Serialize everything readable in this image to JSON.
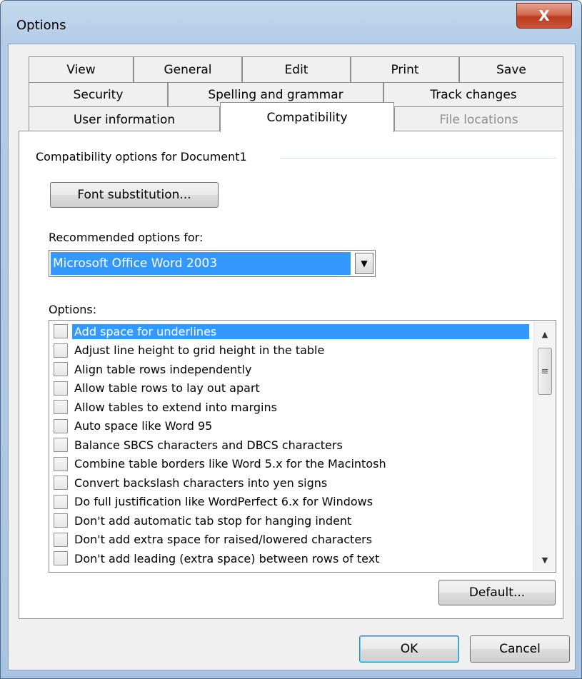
{
  "window": {
    "title": "Options",
    "close_label": "X"
  },
  "tabs": {
    "row1": [
      "View",
      "General",
      "Edit",
      "Print",
      "Save"
    ],
    "row2": [
      "Security",
      "Spelling and grammar",
      "Track changes"
    ],
    "row3": [
      "User information",
      "Compatibility",
      "File locations"
    ],
    "selected": "Compatibility",
    "disabled": "File locations"
  },
  "compat": {
    "group_label": "Compatibility options for Document1",
    "font_substitution_label": "Font substitution...",
    "recommended_label": "Recommended options for:",
    "recommended_value": "Microsoft Office Word 2003",
    "options_label": "Options:",
    "options": [
      "Add space for underlines",
      "Adjust line height to grid height in the table",
      "Align table rows independently",
      "Allow table rows to lay out apart",
      "Allow tables to extend into margins",
      "Auto space like Word 95",
      "Balance SBCS characters and DBCS characters",
      "Combine table borders like Word 5.x for the Macintosh",
      "Convert backslash characters into yen signs",
      "Do full justification like WordPerfect 6.x for Windows",
      "Don't add automatic tab stop for hanging indent",
      "Don't add extra space for raised/lowered characters",
      "Don't add leading (extra space) between rows of text"
    ],
    "selected_option": "Add space for underlines",
    "default_label": "Default..."
  },
  "footer": {
    "ok_label": "OK",
    "cancel_label": "Cancel"
  },
  "colors": {
    "selection": "#3399ff",
    "frame": "#b3cce6",
    "close": "#c9553a"
  }
}
